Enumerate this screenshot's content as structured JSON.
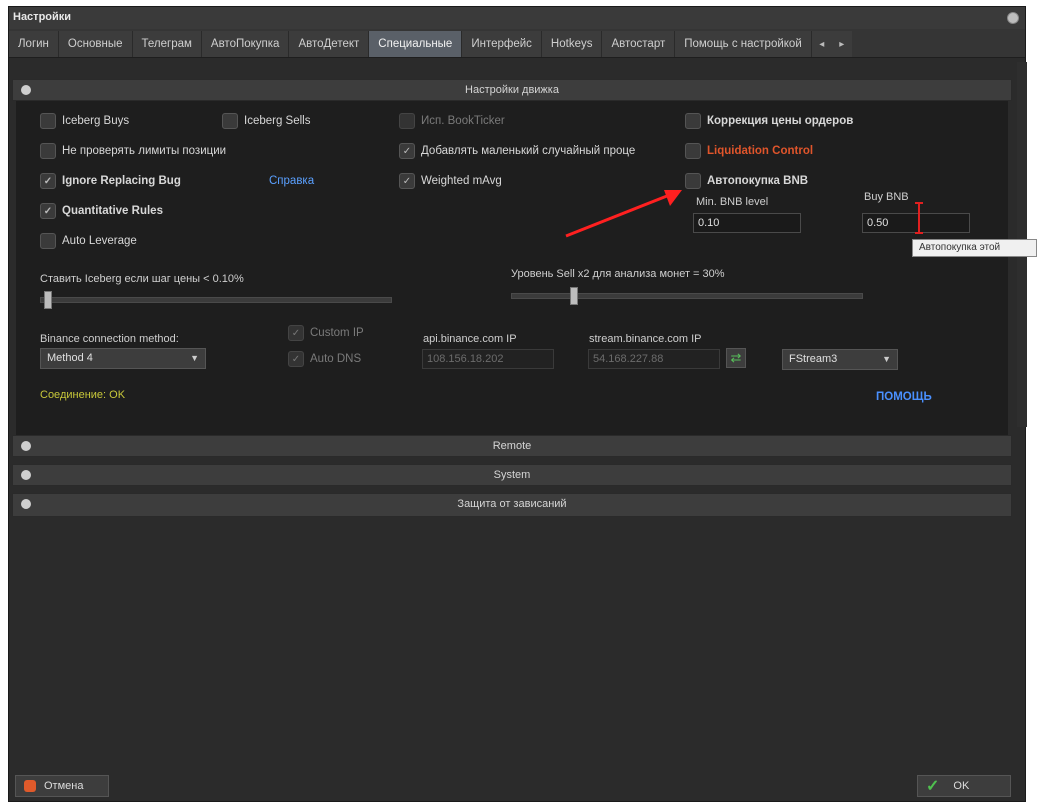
{
  "window": {
    "title": "Настройки"
  },
  "tabs": [
    {
      "label": "Логин"
    },
    {
      "label": "Основные"
    },
    {
      "label": "Телеграм"
    },
    {
      "label": "АвтоПокупка"
    },
    {
      "label": "АвтоДетект"
    },
    {
      "label": "Специальные"
    },
    {
      "label": "Интерфейс"
    },
    {
      "label": "Hotkeys"
    },
    {
      "label": "Автостарт"
    },
    {
      "label": "Помощь с настройкой"
    }
  ],
  "active_tab": "Специальные",
  "engine_section": {
    "title": "Настройки движка",
    "checkboxes": {
      "iceberg_buys": {
        "label": "Iceberg Buys",
        "checked": false
      },
      "iceberg_sells": {
        "label": "Iceberg Sells",
        "checked": false
      },
      "use_bookticker": {
        "label": "Исп. BookTicker",
        "checked": false
      },
      "order_price_correction": {
        "label": "Коррекция цены ордеров",
        "checked": false
      },
      "no_check_position_limits": {
        "label": "Не проверять лимиты позиции",
        "checked": false
      },
      "add_small_random": {
        "label": "Добавлять маленький случайный проце",
        "checked": true
      },
      "liquidation_control": {
        "label": "Liquidation Control",
        "checked": false
      },
      "ignore_replacing_bug": {
        "label": "Ignore Replacing Bug",
        "checked": true
      },
      "weighted_mavg": {
        "label": "Weighted mAvg",
        "checked": true
      },
      "autobuy_bnb": {
        "label": "Автопокупка BNB",
        "checked": false
      },
      "quantitative_rules": {
        "label": "Quantitative Rules",
        "checked": true
      },
      "auto_leverage": {
        "label": "Auto Leverage",
        "checked": false
      },
      "custom_ip": {
        "label": "Custom IP",
        "checked": true
      },
      "auto_dns": {
        "label": "Auto DNS",
        "checked": true
      }
    },
    "help_link": "Справка",
    "min_bnb_label": "Min. BNB level",
    "min_bnb_value": "0.10",
    "buy_bnb_label": "Buy BNB",
    "buy_bnb_value": "0.50",
    "iceberg_slider_label": "Ставить Iceberg если шаг цены < 0.10%",
    "iceberg_slider_level": 0.01,
    "sellx2_slider_label": "Уровень Sell x2 для анализа монет = 30%",
    "sellx2_slider_level": 0.17,
    "connection_label": "Binance connection method:",
    "connection_value": "Method 4",
    "api_ip_label": "api.binance.com IP",
    "api_ip_value": "108.156.18.202",
    "stream_ip_label": "stream.binance.com IP",
    "stream_ip_value": "54.168.227.88",
    "stream_select_value": "FStream3",
    "status": "Соединение: OK",
    "help_button": "ПОМОЩЬ"
  },
  "tooltip": "Автопокупка этой",
  "collapsed_sections": [
    {
      "title": "Remote"
    },
    {
      "title": "System"
    },
    {
      "title": "Защита от зависаний"
    }
  ],
  "footer": {
    "cancel_label": "Отмена",
    "ok_label": "OK"
  },
  "colors": {
    "accent_orange": "#e0552b",
    "link_blue": "#4a90ff",
    "status_yellow": "#c8c83a",
    "arrow_red": "#ff2020"
  }
}
